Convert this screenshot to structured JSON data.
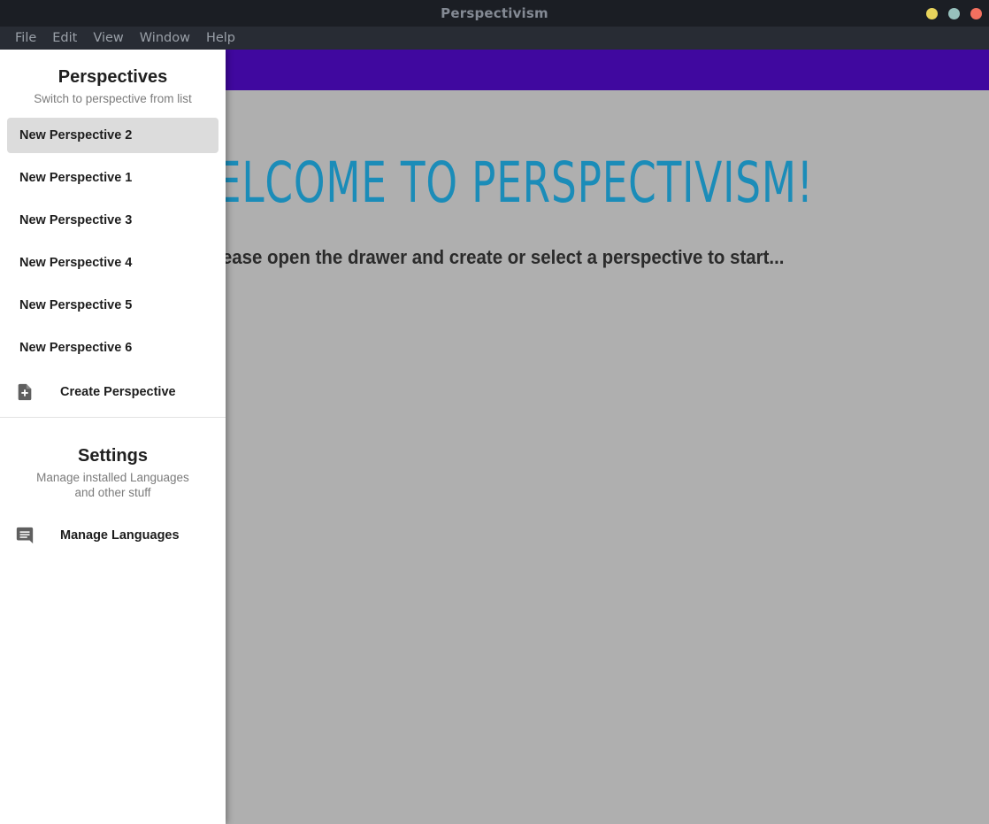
{
  "window": {
    "title": "Perspectivism",
    "controls": [
      {
        "name": "minimize",
        "color": "#e8d45c"
      },
      {
        "name": "maximize",
        "color": "#97c1bd"
      },
      {
        "name": "close",
        "color": "#f4705f"
      }
    ]
  },
  "menubar": {
    "items": [
      {
        "label": "File"
      },
      {
        "label": "Edit"
      },
      {
        "label": "View"
      },
      {
        "label": "Window"
      },
      {
        "label": "Help"
      }
    ]
  },
  "appbar": {
    "color": "#40089f"
  },
  "main": {
    "background_color": "#afafaf",
    "welcome_title": "WELCOME TO PERSPECTIVISM!",
    "welcome_subtitle": "Please open the drawer and create or select a perspective to start...",
    "title_color": "#1b8cb8"
  },
  "drawer": {
    "perspectives": {
      "title": "Perspectives",
      "subtitle": "Switch to perspective from list",
      "items": [
        {
          "label": "New Perspective 2",
          "selected": true
        },
        {
          "label": "New Perspective 1",
          "selected": false
        },
        {
          "label": "New Perspective 3",
          "selected": false
        },
        {
          "label": "New Perspective 4",
          "selected": false
        },
        {
          "label": "New Perspective 5",
          "selected": false
        },
        {
          "label": "New Perspective 6",
          "selected": false
        }
      ],
      "create_action": {
        "label": "Create Perspective",
        "icon": "note-add-icon"
      }
    },
    "settings": {
      "title": "Settings",
      "subtitle": "Manage installed Languages and other stuff",
      "action": {
        "label": "Manage Languages",
        "icon": "comment-icon"
      }
    }
  }
}
